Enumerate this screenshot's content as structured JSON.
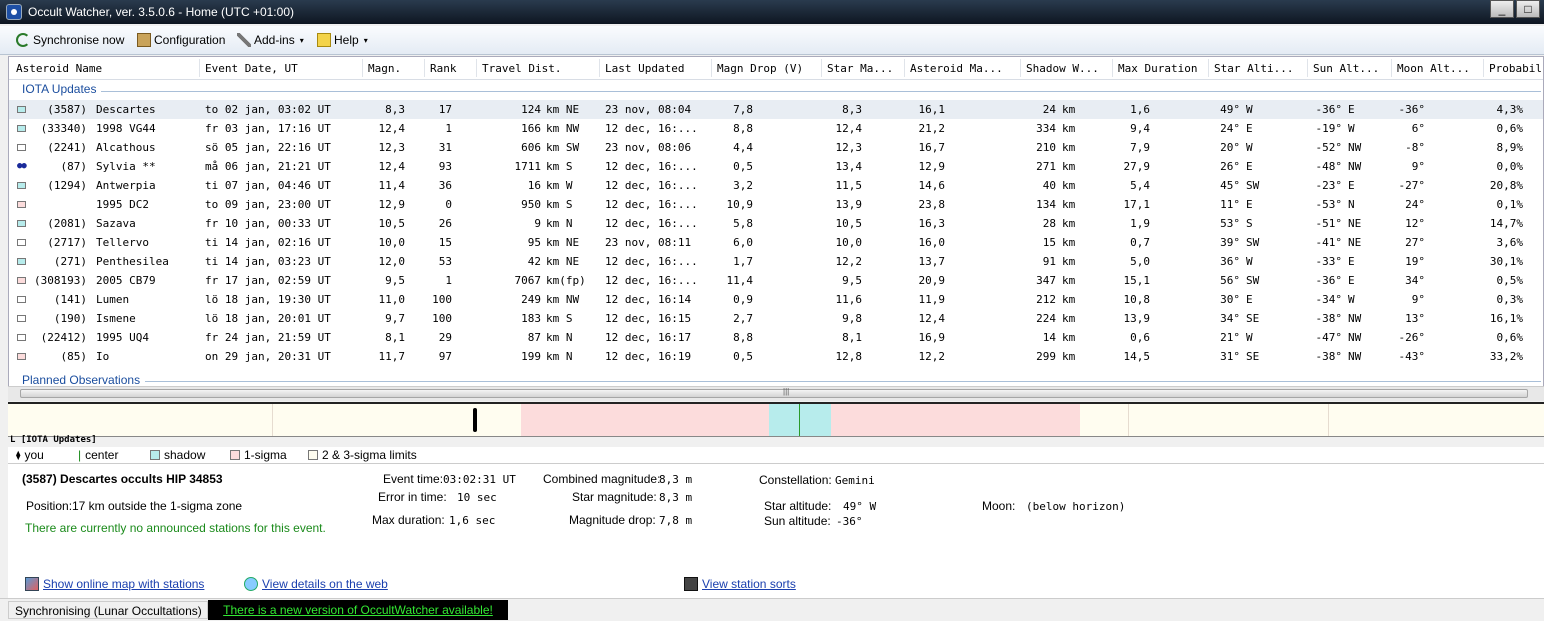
{
  "window": {
    "title": "Occult Watcher, ver. 3.5.0.6 - Home (UTC +01:00)",
    "min": "_",
    "max": "□"
  },
  "toolbar": {
    "synchronise": "Synchronise now",
    "configuration": "Configuration",
    "addins": "Add-ins",
    "help": "Help",
    "caret": "▾"
  },
  "columns": [
    "Asteroid Name",
    "Event Date, UT",
    "Magn.",
    "Rank",
    "Travel Dist.",
    "Last Updated",
    "Magn Drop (V)",
    "Star Ma...",
    "Asteroid Ma...",
    "Shadow W...",
    "Max Duration",
    "Star Alti...",
    "Sun Alt...",
    "Moon Alt...",
    "Probabil"
  ],
  "groups": {
    "iota": "IOTA Updates",
    "planned": "Planned Observations"
  },
  "indicator_colors": {
    "shadow": "#b7ecec",
    "sigma": "#fcdcdc",
    "none": "#ffffff",
    "you": "#1a2a9a"
  },
  "rows": [
    {
      "ind": "shadow",
      "num": "(3587)",
      "name": "Descartes",
      "date": "to 02 jan, 03:02 UT",
      "mag": "8,3",
      "rank": "17",
      "dist": "124",
      "dir": "km NE",
      "upd": "23 nov, 08:04",
      "drop": "7,8",
      "starm": "8,3",
      "astm": "16,1",
      "sw": "24",
      "swu": "km",
      "dur": "1,6",
      "salt": "49°",
      "sdir": "W",
      "sun": "-36°",
      "sundir": "E",
      "moon": "-36°",
      "prob": "4,3%"
    },
    {
      "ind": "shadow",
      "num": "(33340)",
      "name": "1998 VG44",
      "date": "fr 03 jan, 17:16 UT",
      "mag": "12,4",
      "rank": "1",
      "dist": "166",
      "dir": "km NW",
      "upd": "12 dec, 16:...",
      "drop": "8,8",
      "starm": "12,4",
      "astm": "21,2",
      "sw": "334",
      "swu": "km",
      "dur": "9,4",
      "salt": "24°",
      "sdir": "E",
      "sun": "-19°",
      "sundir": "W",
      "moon": "6°",
      "prob": "0,6%"
    },
    {
      "ind": "none",
      "num": "(2241)",
      "name": "Alcathous",
      "date": "sö 05 jan, 22:16 UT",
      "mag": "12,3",
      "rank": "31",
      "dist": "606",
      "dir": "km SW",
      "upd": "23 nov, 08:06",
      "drop": "4,4",
      "starm": "12,3",
      "astm": "16,7",
      "sw": "210",
      "swu": "km",
      "dur": "7,9",
      "salt": "20°",
      "sdir": "W",
      "sun": "-52°",
      "sundir": "NW",
      "moon": "-8°",
      "prob": "8,9%"
    },
    {
      "ind": "you",
      "num": "(87)",
      "name": "Sylvia **",
      "date": "må 06 jan, 21:21 UT",
      "mag": "12,4",
      "rank": "93",
      "dist": "1711",
      "dir": "km S",
      "upd": "12 dec, 16:...",
      "drop": "0,5",
      "starm": "13,4",
      "astm": "12,9",
      "sw": "271",
      "swu": "km",
      "dur": "27,9",
      "salt": "26°",
      "sdir": "E",
      "sun": "-48°",
      "sundir": "NW",
      "moon": "9°",
      "prob": "0,0%"
    },
    {
      "ind": "shadow",
      "num": "(1294)",
      "name": "Antwerpia",
      "date": "ti 07 jan, 04:46 UT",
      "mag": "11,4",
      "rank": "36",
      "dist": "16",
      "dir": "km W",
      "upd": "12 dec, 16:...",
      "drop": "3,2",
      "starm": "11,5",
      "astm": "14,6",
      "sw": "40",
      "swu": "km",
      "dur": "5,4",
      "salt": "45°",
      "sdir": "SW",
      "sun": "-23°",
      "sundir": "E",
      "moon": "-27°",
      "prob": "20,8%"
    },
    {
      "ind": "sigma",
      "num": "",
      "name": "1995 DC2",
      "date": "to 09 jan, 23:00 UT",
      "mag": "12,9",
      "rank": "0",
      "dist": "950",
      "dir": "km S",
      "upd": "12 dec, 16:...",
      "drop": "10,9",
      "starm": "13,9",
      "astm": "23,8",
      "sw": "134",
      "swu": "km",
      "dur": "17,1",
      "salt": "11°",
      "sdir": "E",
      "sun": "-53°",
      "sundir": "N",
      "moon": "24°",
      "prob": "0,1%"
    },
    {
      "ind": "shadow",
      "num": "(2081)",
      "name": "Sazava",
      "date": "fr 10 jan, 00:33 UT",
      "mag": "10,5",
      "rank": "26",
      "dist": "9",
      "dir": "km N",
      "upd": "12 dec, 16:...",
      "drop": "5,8",
      "starm": "10,5",
      "astm": "16,3",
      "sw": "28",
      "swu": "km",
      "dur": "1,9",
      "salt": "53°",
      "sdir": "S",
      "sun": "-51°",
      "sundir": "NE",
      "moon": "12°",
      "prob": "14,7%"
    },
    {
      "ind": "none",
      "num": "(2717)",
      "name": "Tellervo",
      "date": "ti 14 jan, 02:16 UT",
      "mag": "10,0",
      "rank": "15",
      "dist": "95",
      "dir": "km NE",
      "upd": "23 nov, 08:11",
      "drop": "6,0",
      "starm": "10,0",
      "astm": "16,0",
      "sw": "15",
      "swu": "km",
      "dur": "0,7",
      "salt": "39°",
      "sdir": "SW",
      "sun": "-41°",
      "sundir": "NE",
      "moon": "27°",
      "prob": "3,6%"
    },
    {
      "ind": "shadow",
      "num": "(271)",
      "name": "Penthesilea",
      "date": "ti 14 jan, 03:23 UT",
      "mag": "12,0",
      "rank": "53",
      "dist": "42",
      "dir": "km NE",
      "upd": "12 dec, 16:...",
      "drop": "1,7",
      "starm": "12,2",
      "astm": "13,7",
      "sw": "91",
      "swu": "km",
      "dur": "5,0",
      "salt": "36°",
      "sdir": "W",
      "sun": "-33°",
      "sundir": "E",
      "moon": "19°",
      "prob": "30,1%"
    },
    {
      "ind": "sigma",
      "num": "(308193)",
      "name": "2005 CB79",
      "date": "fr 17 jan, 02:59 UT",
      "mag": "9,5",
      "rank": "1",
      "dist": "7067",
      "dir": "km(fp)",
      "upd": "12 dec, 16:...",
      "drop": "11,4",
      "starm": "9,5",
      "astm": "20,9",
      "sw": "347",
      "swu": "km",
      "dur": "15,1",
      "salt": "56°",
      "sdir": "SW",
      "sun": "-36°",
      "sundir": "E",
      "moon": "34°",
      "prob": "0,5%"
    },
    {
      "ind": "none",
      "num": "(141)",
      "name": "Lumen",
      "date": "lö 18 jan, 19:30 UT",
      "mag": "11,0",
      "rank": "100",
      "dist": "249",
      "dir": "km NW",
      "upd": "12 dec, 16:14",
      "drop": "0,9",
      "starm": "11,6",
      "astm": "11,9",
      "sw": "212",
      "swu": "km",
      "dur": "10,8",
      "salt": "30°",
      "sdir": "E",
      "sun": "-34°",
      "sundir": "W",
      "moon": "9°",
      "prob": "0,3%"
    },
    {
      "ind": "none",
      "num": "(190)",
      "name": "Ismene",
      "date": "lö 18 jan, 20:01 UT",
      "mag": "9,7",
      "rank": "100",
      "dist": "183",
      "dir": "km S",
      "upd": "12 dec, 16:15",
      "drop": "2,7",
      "starm": "9,8",
      "astm": "12,4",
      "sw": "224",
      "swu": "km",
      "dur": "13,9",
      "salt": "34°",
      "sdir": "SE",
      "sun": "-38°",
      "sundir": "NW",
      "moon": "13°",
      "prob": "16,1%"
    },
    {
      "ind": "none",
      "num": "(22412)",
      "name": "1995 UQ4",
      "date": "fr 24 jan, 21:59 UT",
      "mag": "8,1",
      "rank": "29",
      "dist": "87",
      "dir": "km N",
      "upd": "12 dec, 16:17",
      "drop": "8,8",
      "starm": "8,1",
      "astm": "16,9",
      "sw": "14",
      "swu": "km",
      "dur": "0,6",
      "salt": "21°",
      "sdir": "W",
      "sun": "-47°",
      "sundir": "NW",
      "moon": "-26°",
      "prob": "0,6%"
    },
    {
      "ind": "sigma",
      "num": "(85)",
      "name": "Io",
      "date": "on 29 jan, 20:31 UT",
      "mag": "11,7",
      "rank": "97",
      "dist": "199",
      "dir": "km N",
      "upd": "12 dec, 16:19",
      "drop": "0,5",
      "starm": "12,8",
      "astm": "12,2",
      "sw": "299",
      "swu": "km",
      "dur": "14,5",
      "salt": "31°",
      "sdir": "SE",
      "sun": "-38°",
      "sundir": "NW",
      "moon": "-43°",
      "prob": "33,2%"
    }
  ],
  "strip": {
    "label": "L [IOTA Updates]"
  },
  "legend": {
    "you": "you",
    "center": "center",
    "shadow": "shadow",
    "sigma1": "1-sigma",
    "sigma23": "2 & 3-sigma limits",
    "you_glyph": "⧫",
    "center_glyph": "|"
  },
  "details": {
    "title": "(3587) Descartes occults HIP  34853",
    "position_label": "Position:",
    "position_value": "17 km outside the 1-sigma zone",
    "stations": "There are currently no announced stations for this event.",
    "event_time_label": "Event time:",
    "event_time": "03:02:31 UT",
    "error_label": "Error in time:",
    "error": "10 sec",
    "maxdur_label": "Max duration:",
    "maxdur": "1,6 sec",
    "combmag_label": "Combined magnitude:",
    "combmag": "8,3 m",
    "starmag_label": "Star magnitude:",
    "starmag": "8,3 m",
    "magdrop_label": "Magnitude drop:",
    "magdrop": "7,8 m",
    "const_label": "Constellation:",
    "const": "Gemini",
    "staralt_label": "Star altitude:",
    "staralt": "49° W",
    "sunalt_label": "Sun altitude:",
    "sunalt": "-36°",
    "moon_label": "Moon:",
    "moon": "(below horizon)"
  },
  "links": {
    "map": "Show online map with stations",
    "web": "View details on the web",
    "sorts": "View station sorts"
  },
  "status": {
    "left": "Synchronising (Lunar Occultations)",
    "newversion": "There is a new version of OccultWatcher available!"
  }
}
